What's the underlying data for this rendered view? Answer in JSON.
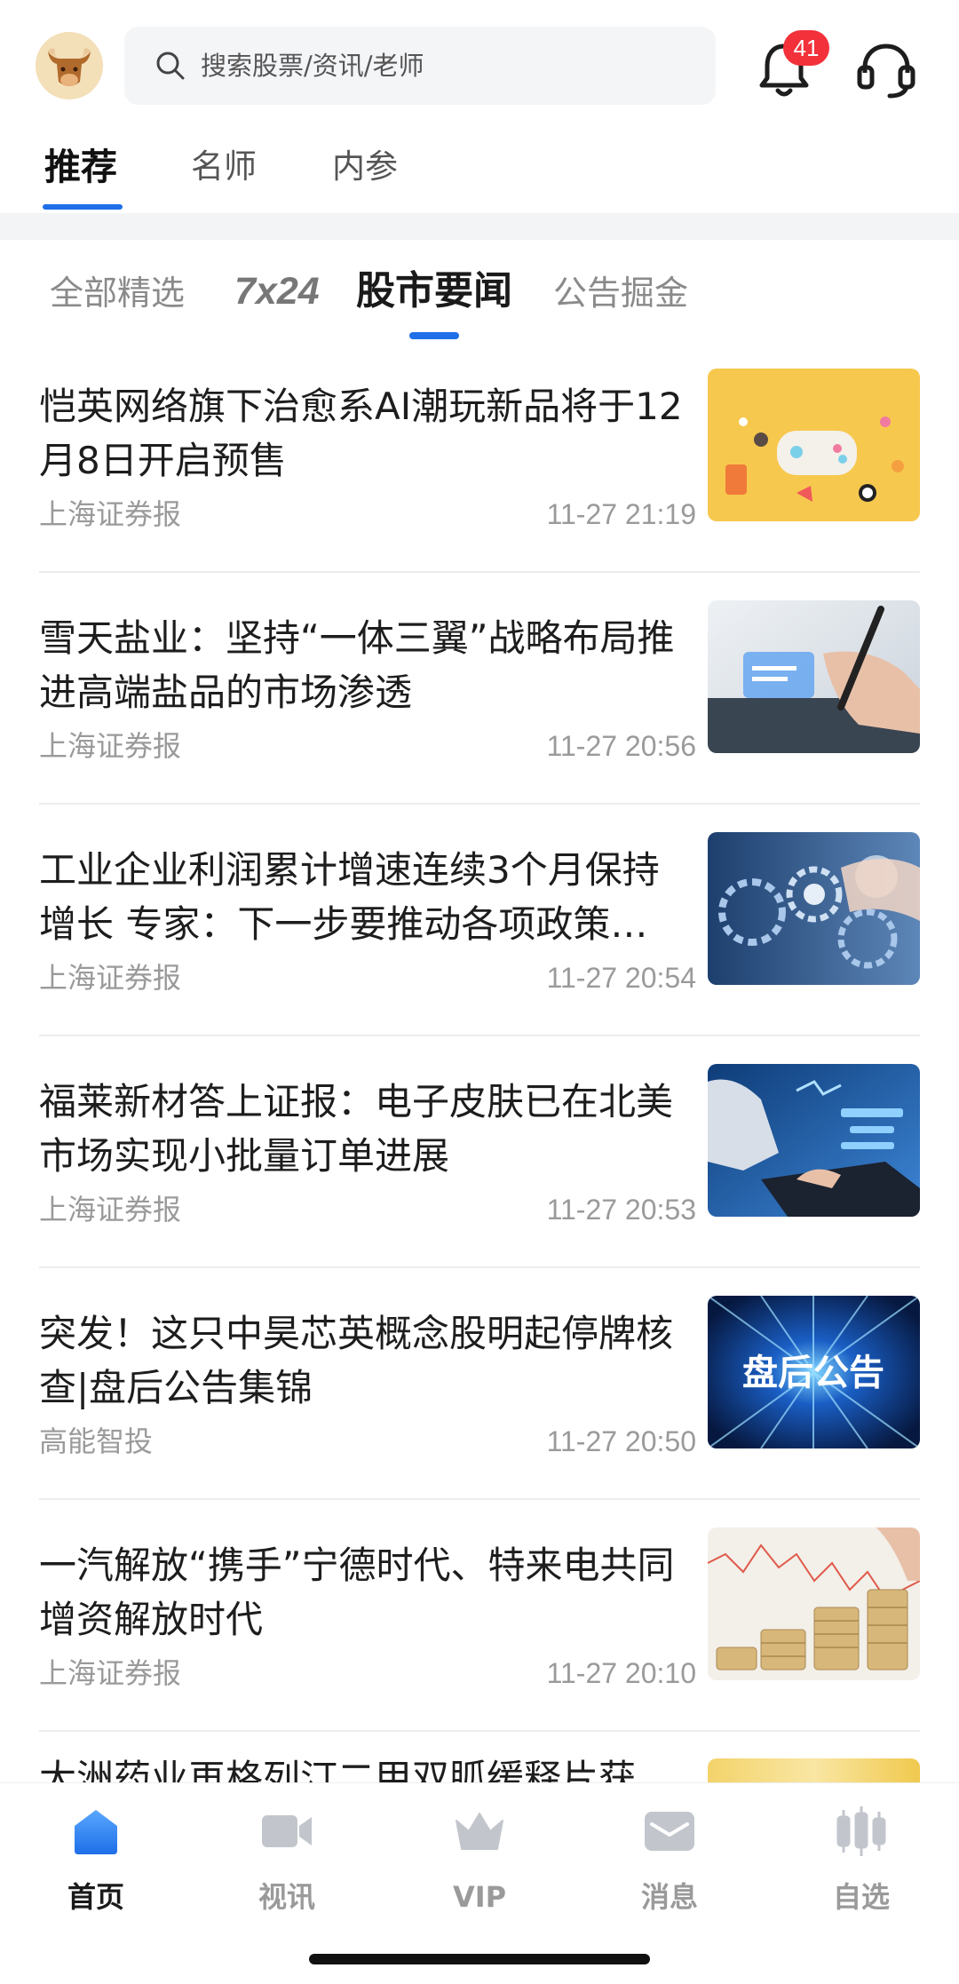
{
  "header": {
    "search_placeholder": "搜索股票/资讯/老师",
    "notification_count": "41",
    "icons": [
      "bull-avatar-icon",
      "search-icon",
      "bell-icon",
      "customer-service-icon"
    ]
  },
  "primary_tabs": [
    {
      "label": "推荐",
      "active": true
    },
    {
      "label": "名师",
      "active": false
    },
    {
      "label": "内参",
      "active": false
    }
  ],
  "sub_tabs": [
    {
      "label": "全部精选",
      "active": false
    },
    {
      "label": "7x24",
      "active": false
    },
    {
      "label": "股市要闻",
      "active": true
    },
    {
      "label": "公告掘金",
      "active": false
    }
  ],
  "news": [
    {
      "title": "恺英网络旗下治愈系AI潮玩新品将于12月8日开启预售",
      "source": "上海证券报",
      "time": "11-27 21:19",
      "thumb_icon": "toys-image"
    },
    {
      "title": "雪天盐业：坚持“一体三翼”战略布局推进高端盐品的市场渗透",
      "source": "上海证券报",
      "time": "11-27 20:56",
      "thumb_icon": "pen-tablet-image"
    },
    {
      "title": "工业企业利润累计增速连续3个月保持增长 专家：下一步要推动各项政策…",
      "source": "上海证券报",
      "time": "11-27 20:54",
      "thumb_icon": "gears-tech-image"
    },
    {
      "title": "福莱新材答上证报：电子皮肤已在北美市场实现小批量订单进展",
      "source": "上海证券报",
      "time": "11-27 20:53",
      "thumb_icon": "laptop-data-image"
    },
    {
      "title": "突发！这只中昊芯英概念股明起停牌核查|盘后公告集锦",
      "source": "高能智投",
      "time": "11-27 20:50",
      "thumb_icon": "announcement-banner-image",
      "thumb_text": "盘后公告"
    },
    {
      "title": "一汽解放“携手”宁德时代、特来电共同增资解放时代",
      "source": "上海证券报",
      "time": "11-27 20:10",
      "thumb_icon": "coins-chart-image"
    }
  ],
  "partial_news": {
    "title": "大洲药业再格列汀二甲双胍缓释片获"
  },
  "bottom_nav": [
    {
      "label": "首页",
      "icon": "home-icon",
      "active": true
    },
    {
      "label": "视讯",
      "icon": "video-icon",
      "active": false
    },
    {
      "label": "VIP",
      "icon": "crown-icon",
      "active": false
    },
    {
      "label": "消息",
      "icon": "mail-icon",
      "active": false
    },
    {
      "label": "自选",
      "icon": "candlestick-icon",
      "active": false
    }
  ],
  "colors": {
    "accent": "#1e6fe8",
    "badge": "#f2313b"
  }
}
